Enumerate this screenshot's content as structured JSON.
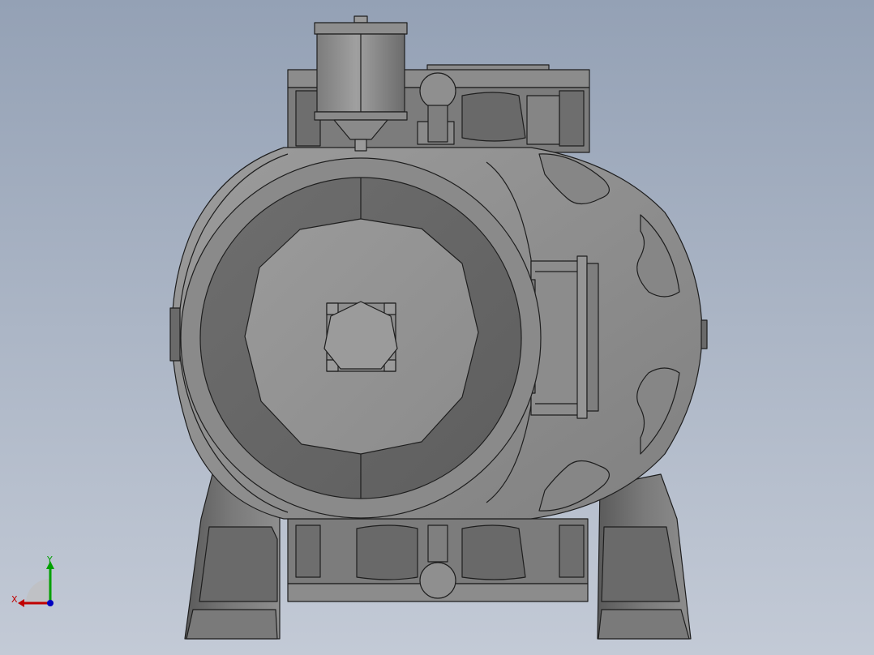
{
  "viewport": {
    "background_top": "#94a1b5",
    "background_bottom": "#c3cad6",
    "model": "pump-assembly",
    "view": "front"
  },
  "triad": {
    "x_label": "X",
    "y_label": "Y",
    "x_color": "#c00000",
    "y_color": "#00a000",
    "z_color": "#0000c0"
  }
}
